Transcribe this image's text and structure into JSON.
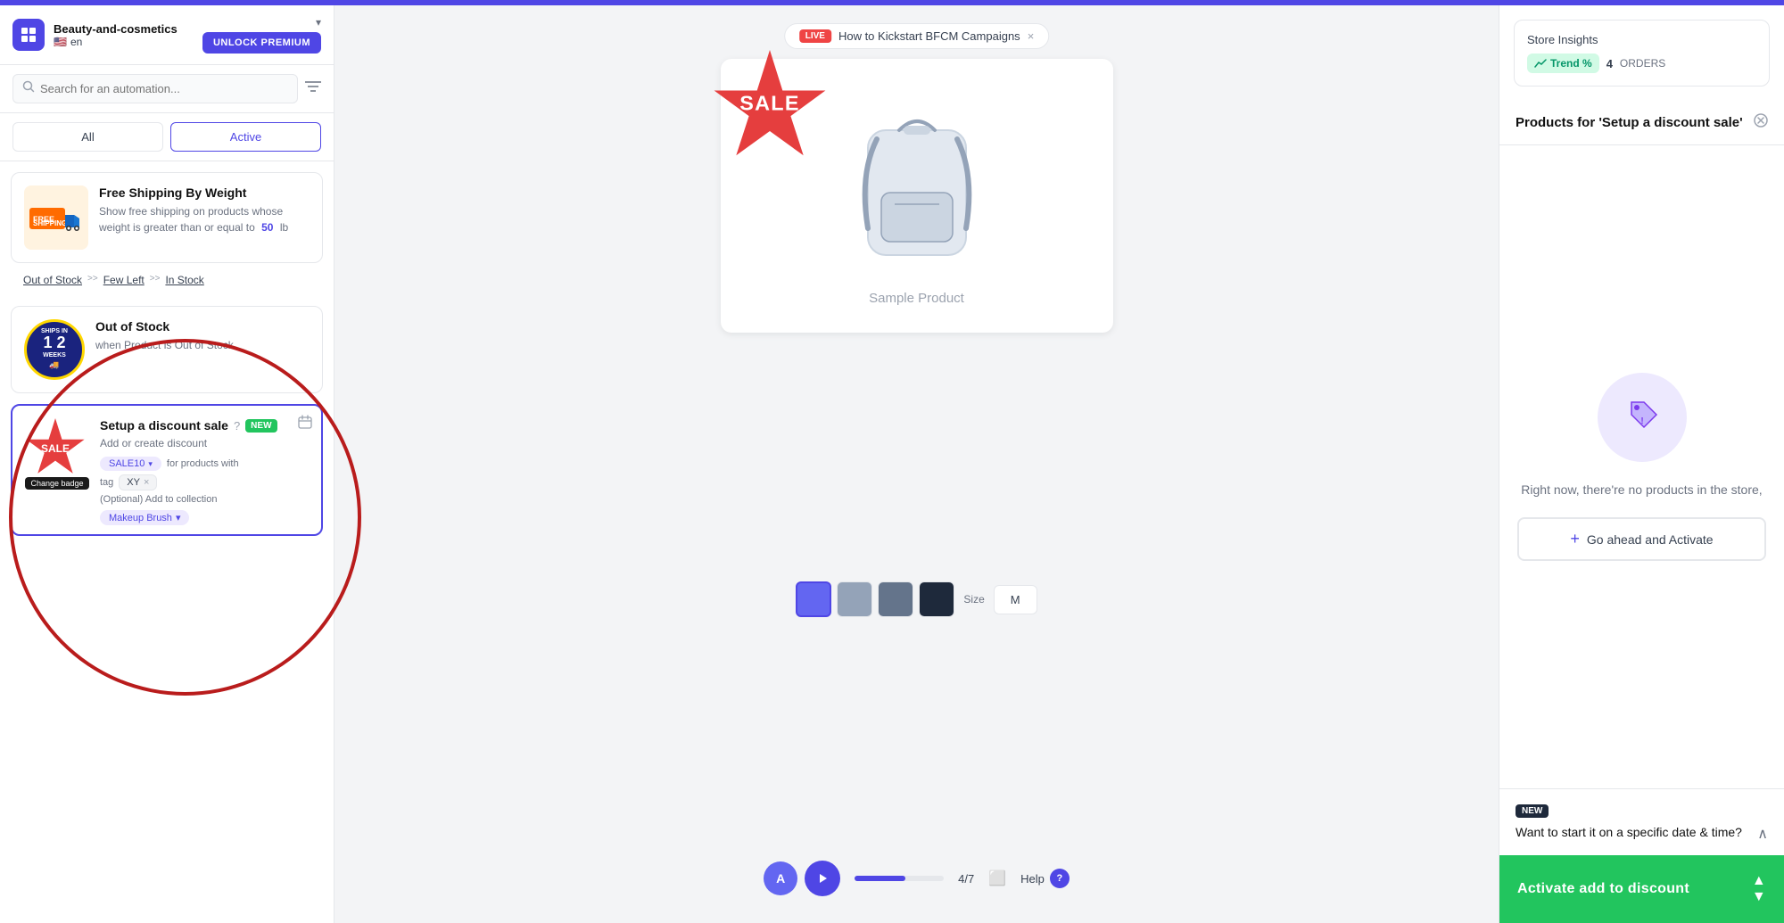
{
  "topbar": {
    "store_name": "Beauty-and-cosmetics",
    "dropdown_arrow": "▾",
    "unlock_btn": "UNLOCK PREMIUM",
    "lang": "en",
    "flag": "🇺🇸"
  },
  "search": {
    "placeholder": "Search for an automation..."
  },
  "tabs": {
    "all_label": "All",
    "active_label": "Active"
  },
  "stock_links": {
    "out_of_stock": "Out of Stock",
    "few_left": "Few Left",
    "in_stock": "In Stock",
    "separator1": ">>",
    "separator2": ">>"
  },
  "automations": [
    {
      "id": "free-shipping",
      "title": "Free Shipping By Weight",
      "description": "Show free shipping on products whose weight is greater than or equal to",
      "weight_value": "50",
      "weight_unit": "lb"
    },
    {
      "id": "out-of-stock",
      "title": "Out of Stock",
      "description": "when Product is Out of Stock"
    },
    {
      "id": "discount-sale",
      "title": "Setup a discount sale",
      "description": "Add or create discount",
      "tag_label": "SALE10",
      "for_products_label": "for products with",
      "tag_name": "XY",
      "optional_label": "(Optional) Add to collection",
      "collection": "Makeup Brush",
      "badge_change": "Change badge",
      "badge_new": "NEW"
    }
  ],
  "live_banner": {
    "live_label": "LIVE",
    "text": "How to Kickstart BFCM Campaigns",
    "close": "×"
  },
  "product_preview": {
    "sale_text": "SALE",
    "product_name": "Sample Product",
    "size_label": "Size",
    "size_value": "M"
  },
  "bottom_nav": {
    "page_count": "4/7",
    "help_label": "Help",
    "help_icon": "?"
  },
  "store_insights": {
    "title": "Store Insights",
    "trend_label": "Trend %",
    "orders_count": "4",
    "orders_label": "ORDERS"
  },
  "right_panel": {
    "title": "Products for 'Setup a discount sale'",
    "empty_text": "Right now, there're no products in the store,",
    "activate_btn": "+ Go ahead and Activate",
    "plus": "+",
    "activate_text": "Go ahead and Activate",
    "new_badge": "NEW",
    "new_question": "Want to start it on a specific date & time?",
    "bottom_btn": "Activate add to discount"
  },
  "colors": {
    "primary": "#4f46e5",
    "success": "#22c55e",
    "danger": "#ef4444",
    "dark": "#1e293b"
  }
}
